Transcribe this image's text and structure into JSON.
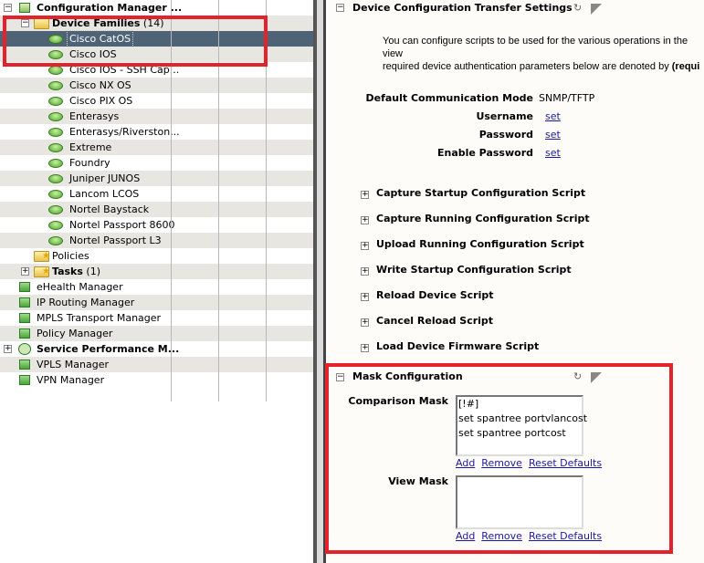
{
  "tree": {
    "root": {
      "label": "Configuration Manager ..."
    },
    "device_families": {
      "label": "Device Families",
      "count": "(14)"
    },
    "families": [
      "Cisco CatOS",
      "Cisco IOS",
      "Cisco IOS - SSH Cap...",
      "Cisco NX OS",
      "Cisco PIX OS",
      "Enterasys",
      "Enterasys/Riverston...",
      "Extreme",
      "Foundry",
      "Juniper JUNOS",
      "Lancom LCOS",
      "Nortel Baystack",
      "Nortel Passport 8600",
      "Nortel Passport L3"
    ],
    "selected": "Cisco CatOS",
    "policies": {
      "label": "Policies"
    },
    "tasks": {
      "label": "Tasks",
      "count": "(1)"
    },
    "managers": [
      "eHealth Manager",
      "IP Routing Manager",
      "MPLS Transport Manager",
      "Policy Manager"
    ],
    "service_perf": {
      "label": "Service Performance M..."
    },
    "managers2": [
      "VPLS Manager",
      "VPN Manager"
    ]
  },
  "transfer": {
    "title": "Device Configuration Transfer Settings",
    "desc1": "You can configure scripts to be used for the various operations in the view",
    "desc2_pre": "required device authentication parameters below are denoted by ",
    "desc2_bold": "(requi",
    "fields": {
      "mode_label": "Default Communication Mode",
      "mode_value": "SNMP/TFTP",
      "username_label": "Username",
      "password_label": "Password",
      "enable_label": "Enable Password",
      "set": "set"
    },
    "scripts": [
      "Capture Startup Configuration Script",
      "Capture Running Configuration Script",
      "Upload Running Configuration Script",
      "Write Startup Configuration Script",
      "Reload Device Script",
      "Cancel Reload Script",
      "Load Device Firmware Script"
    ]
  },
  "mask": {
    "title": "Mask Configuration",
    "comparison_label": "Comparison Mask",
    "comparison_value": "[!#]\nset spantree portvlancost\nset spantree portcost",
    "view_label": "View Mask",
    "view_value": "",
    "add": "Add",
    "remove": "Remove",
    "reset": "Reset Defaults"
  },
  "colors": {
    "highlight": "#e3222b",
    "selection": "#4f6377"
  }
}
